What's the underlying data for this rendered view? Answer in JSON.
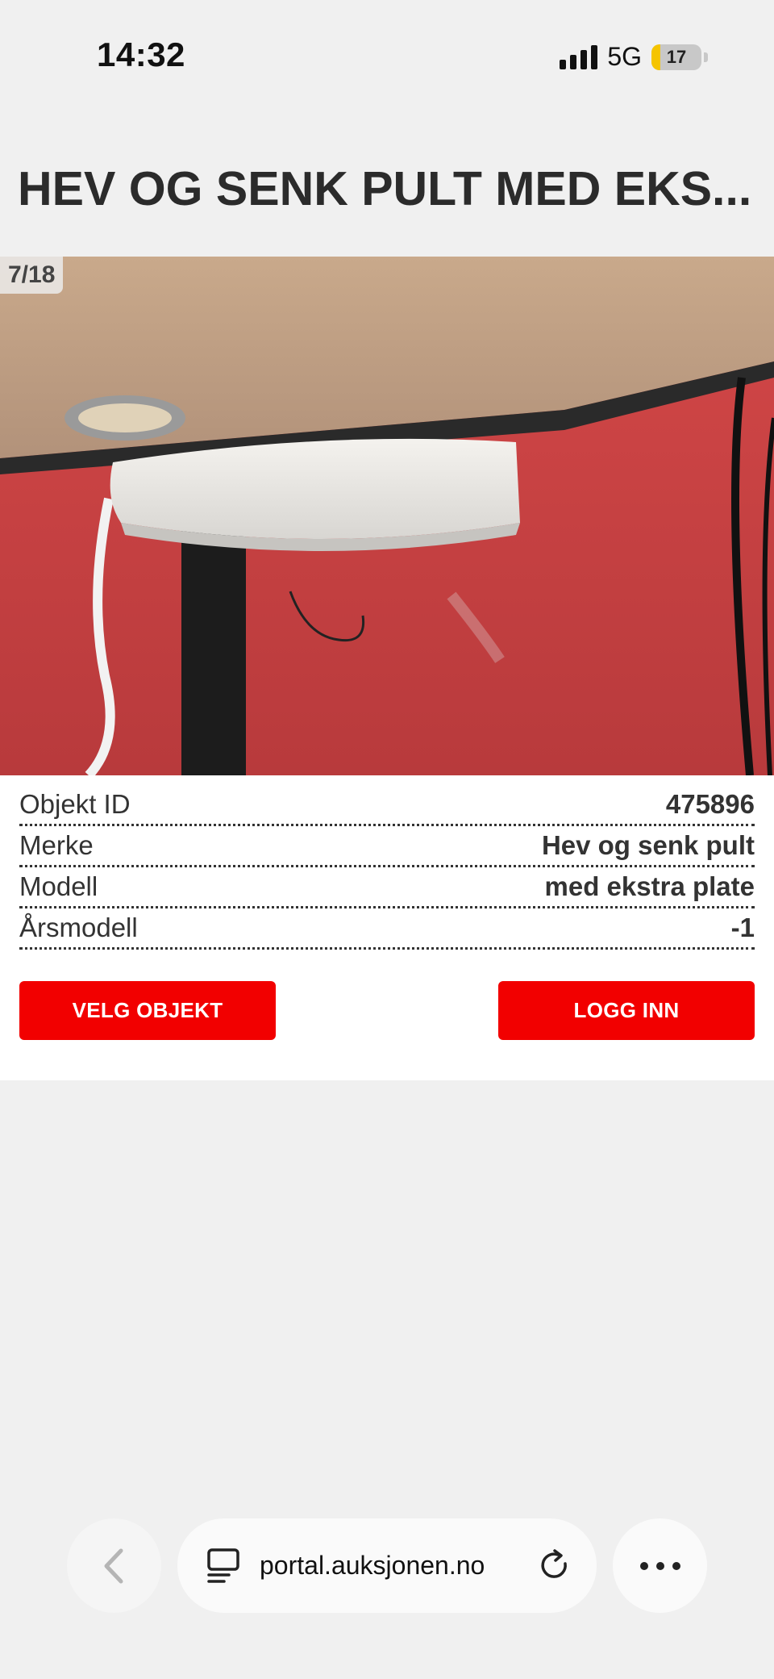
{
  "status_bar": {
    "time": "14:32",
    "network": "5G",
    "battery_level": "17",
    "battery_fraction": 0.17,
    "icons": [
      "signal-icon",
      "battery-icon"
    ]
  },
  "page": {
    "title": "HEV OG SENK PULT MED EKS..."
  },
  "gallery": {
    "counter": "7/18"
  },
  "details": {
    "rows": [
      {
        "label": "Objekt ID",
        "value": "475896"
      },
      {
        "label": "Merke",
        "value": "Hev og senk pult"
      },
      {
        "label": "Modell",
        "value": "med ekstra plate"
      },
      {
        "label": "Årsmodell",
        "value": "-1"
      }
    ]
  },
  "actions": {
    "select_label": "VELG OBJEKT",
    "login_label": "LOGG INN",
    "accent_color": "#f20000"
  },
  "browser": {
    "url": "portal.auksjonen.no",
    "icons": [
      "back-icon",
      "tabs-icon",
      "reload-icon",
      "more-icon"
    ]
  }
}
